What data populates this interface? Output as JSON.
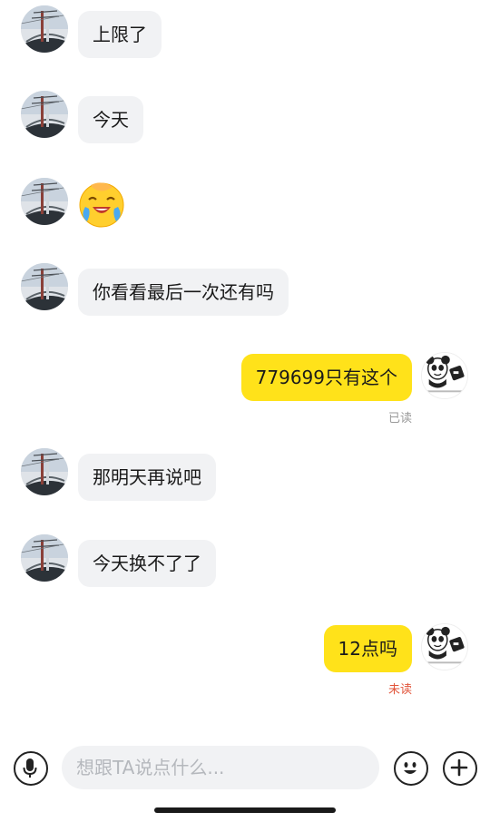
{
  "messages": [
    {
      "side": "in",
      "text": "上限了"
    },
    {
      "side": "in",
      "text": "今天"
    },
    {
      "side": "in",
      "emoji": "crying-laughing-face-emoji"
    },
    {
      "side": "in",
      "text": "你看看最后一次还有吗"
    },
    {
      "side": "out",
      "text": "779699只有这个",
      "status": "已读"
    },
    {
      "side": "in",
      "text": "那明天再说吧"
    },
    {
      "side": "in",
      "text": "今天换不了了"
    },
    {
      "side": "out",
      "text": "12点吗",
      "status": "未读"
    }
  ],
  "colors": {
    "incoming_bubble": "#f1f2f4",
    "outgoing_bubble": "#ffe21a",
    "read_status": "#9a9a9a",
    "unread_status": "#e2553b"
  },
  "input": {
    "placeholder": "想跟TA说点什么...",
    "value": ""
  },
  "icons": {
    "voice": "microphone-icon",
    "emoji": "smiley-face-icon",
    "more": "plus-icon"
  }
}
